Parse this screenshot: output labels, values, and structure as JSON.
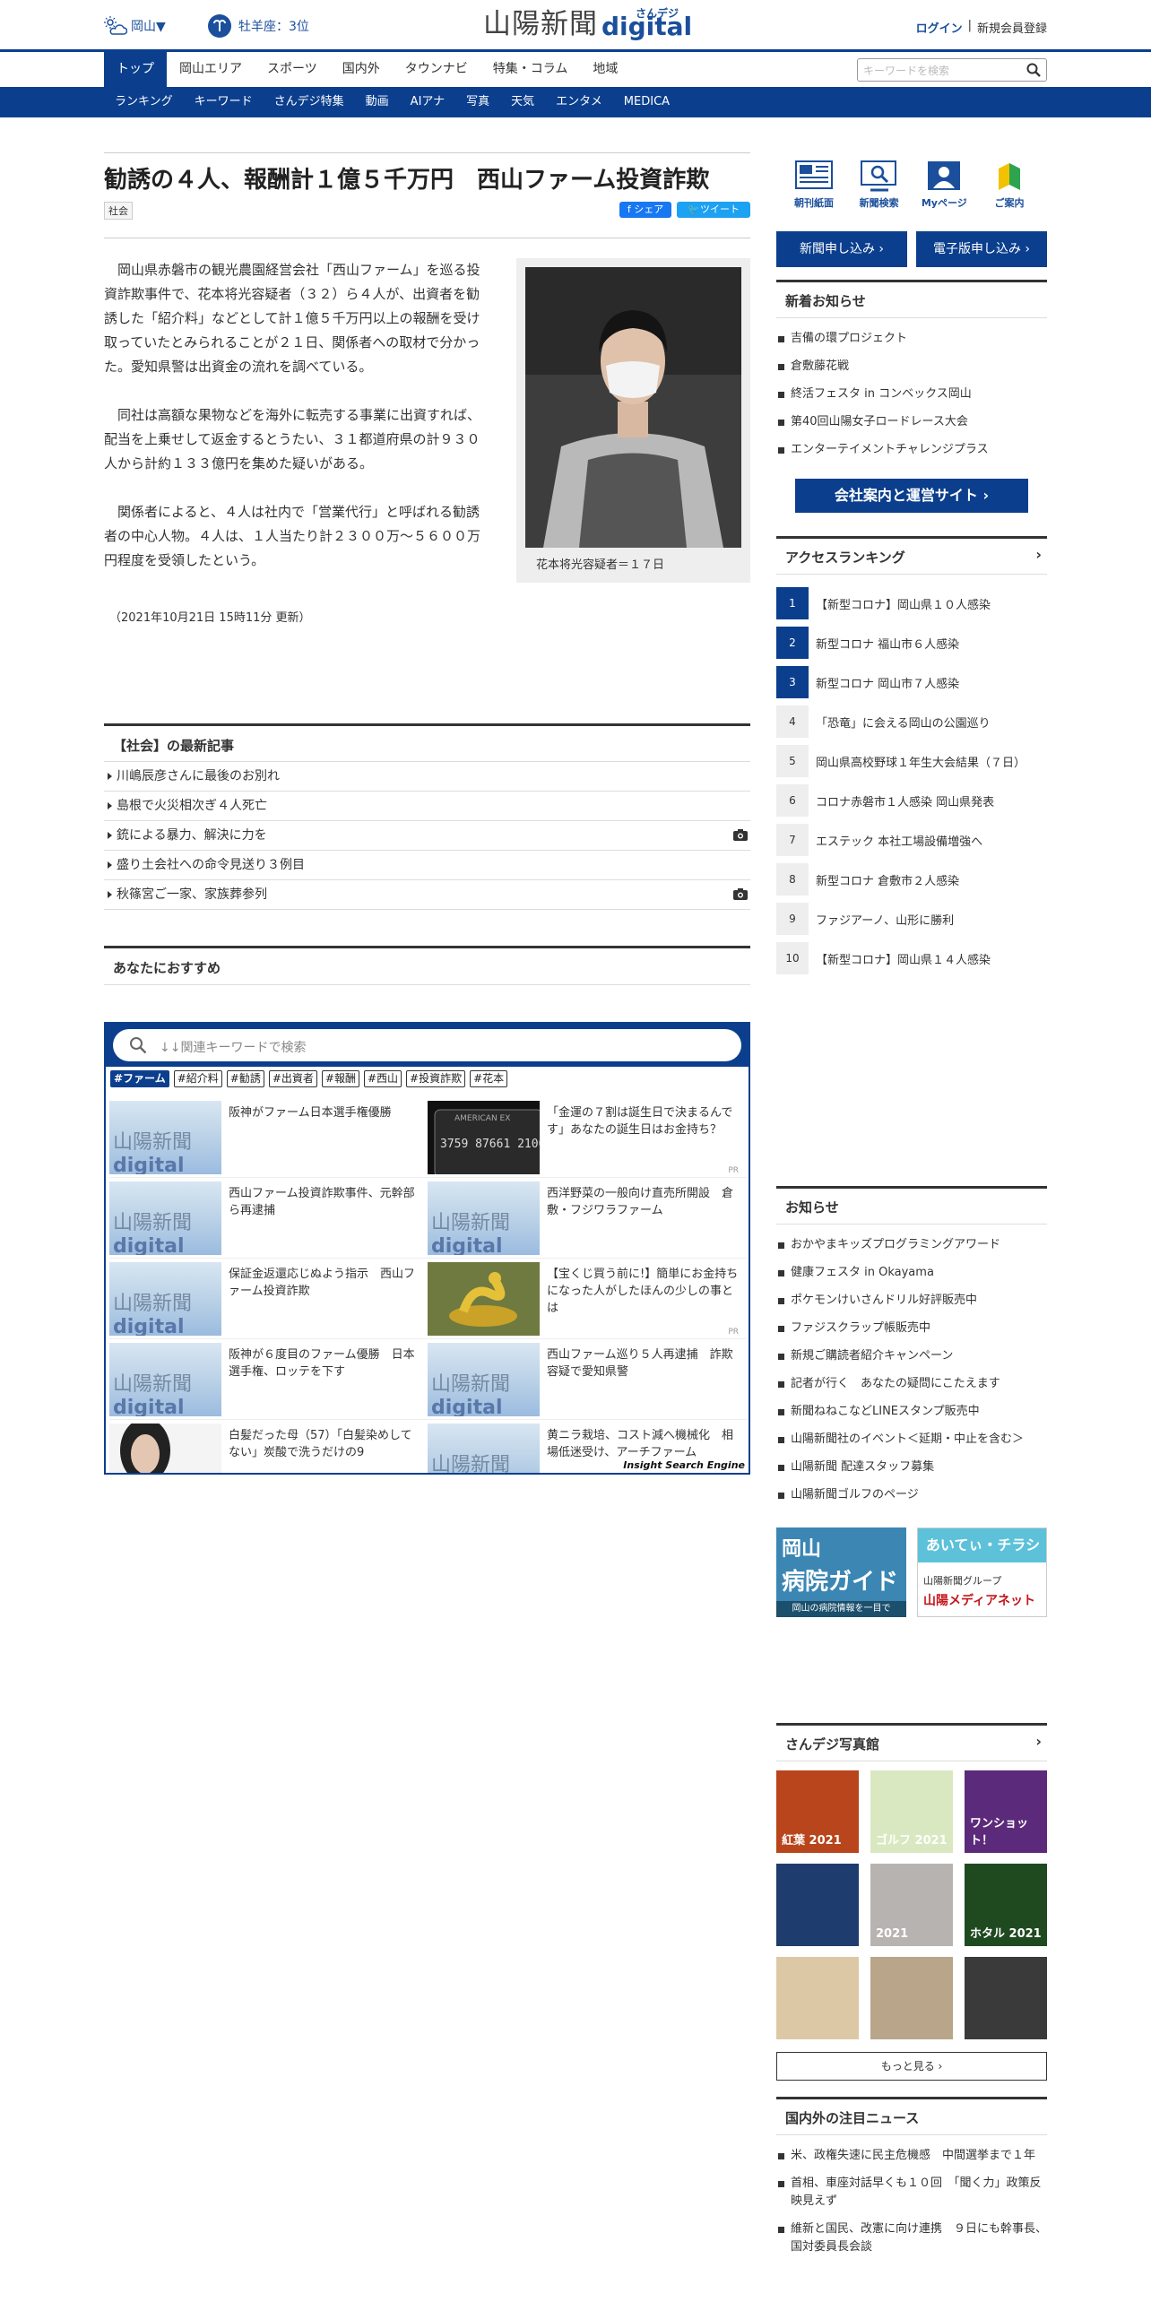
{
  "header": {
    "weather_region": "岡山▼",
    "horoscope": "牡羊座：3位",
    "logo_main": "山陽新聞",
    "logo_sub_kana": "さんデジ",
    "logo_sub": "digital",
    "login": "ログイン",
    "register": "新規会員登録"
  },
  "nav_primary": [
    "トップ",
    "岡山エリア",
    "スポーツ",
    "国内外",
    "タウンナビ",
    "特集・コラム",
    "地域"
  ],
  "search": {
    "placeholder": "キーワードを検索"
  },
  "nav_secondary": [
    "ランキング",
    "キーワード",
    "さんデジ特集",
    "動画",
    "AIアナ",
    "写真",
    "天気",
    "エンタメ",
    "MEDICA"
  ],
  "article": {
    "title": "勧誘の４人、報酬計１億５千万円　西山ファーム投資詐欺",
    "category": "社会",
    "share_fb": "シェア",
    "share_tw": "ツイート",
    "paragraphs": [
      "岡山県赤磐市の観光農園経営会社「西山ファーム」を巡る投資詐欺事件で、花本将光容疑者（３２）ら４人が、出資者を勧誘した「紹介料」などとして計１億５千万円以上の報酬を受け取っていたとみられることが２１日、関係者への取材で分かった。愛知県警は出資金の流れを調べている。",
      "同社は高額な果物などを海外に転売する事業に出資すれば、配当を上乗せして返金するとうたい、３１都道府県の計９３０人から計約１３３億円を集めた疑いがある。",
      "関係者によると、４人は社内で「営業代行」と呼ばれる勧誘者の中心人物。４人は、１人当たり計２３００万～５６００万円程度を受領したという。"
    ],
    "photo_caption": "花本将光容疑者＝１７日",
    "updated": "（2021年10月21日 15時11分 更新）"
  },
  "latest": {
    "heading": "【社会】の最新記事",
    "items": [
      {
        "title": "川嶋辰彦さんに最後のお別れ",
        "photo": false
      },
      {
        "title": "島根で火災相次ぎ４人死亡",
        "photo": false
      },
      {
        "title": "銃による暴力、解決に力を",
        "photo": true
      },
      {
        "title": "盛り土会社への命令見送り３例目",
        "photo": false
      },
      {
        "title": "秋篠宮ご一家、家族葬参列",
        "photo": true
      }
    ]
  },
  "recommend": {
    "heading": "あなたにおすすめ"
  },
  "ise": {
    "placeholder": "↓↓関連キーワードで検索",
    "tags": [
      "#ファーム",
      "#紹介料",
      "#勧誘",
      "#出資者",
      "#報酬",
      "#西山",
      "#投資詐欺",
      "#花本"
    ],
    "rows": [
      [
        {
          "text": "阪神がファーム日本選手権優勝",
          "pr": false,
          "thumb": "logo"
        },
        {
          "text": "「金運の７割は誕生日で決まるんです」あなたの誕生日はお金持ち？",
          "pr": true,
          "thumb": "card"
        }
      ],
      [
        {
          "text": "西山ファーム投資詐欺事件、元幹部ら再逮捕",
          "pr": false,
          "thumb": "logo"
        },
        {
          "text": "西洋野菜の一般向け直売所開設　倉敷・フジワラファーム",
          "pr": false,
          "thumb": "logo"
        }
      ],
      [
        {
          "text": "保証金返還応じぬよう指示　西山ファーム投資詐欺",
          "pr": false,
          "thumb": "logo"
        },
        {
          "text": "【宝くじ買う前に!】簡単にお金持ちになった人がしたほんの少しの事とは",
          "pr": true,
          "thumb": "snake"
        }
      ],
      [
        {
          "text": "阪神が６度目のファーム優勝　日本選手権、ロッテを下す",
          "pr": false,
          "thumb": "logo"
        },
        {
          "text": "西山ファーム巡り５人再逮捕　詐欺容疑で愛知県警",
          "pr": false,
          "thumb": "logo"
        }
      ],
      [
        {
          "text": "白髪だった母（57）「白髪染めしてない」炭酸で洗うだけの9",
          "pr": false,
          "thumb": "woman"
        },
        {
          "text": "黄ニラ栽培、コスト減へ機械化　相場低迷受け、アーチファーム",
          "pr": false,
          "thumb": "logo"
        }
      ]
    ],
    "footer": "Insight Search Engine",
    "pr_label": "PR",
    "thumb_logo": "山陽新聞",
    "thumb_logo_sub": "digital"
  },
  "sidebar": {
    "quick": [
      {
        "label": "朝刊紙面",
        "icon": "newspaper-icon"
      },
      {
        "label": "新聞検索",
        "icon": "monitor-search-icon"
      },
      {
        "label": "Myページ",
        "icon": "user-page-icon"
      },
      {
        "label": "ご案内",
        "icon": "beginner-mark-icon"
      }
    ],
    "btn_subscribe": "新聞申し込み ›",
    "btn_digital": "電子版申し込み ›",
    "news": {
      "heading": "新着お知らせ",
      "items": [
        "吉備の環プロジェクト",
        "倉敷藤花戦",
        "終活フェスタ in コンベックス岡山",
        "第40回山陽女子ロードレース大会",
        "エンターテイメントチャレンジプラス"
      ]
    },
    "company_banner": "会社案内と運営サイト ›",
    "ranking": {
      "heading": "アクセスランキング",
      "items": [
        "【新型コロナ】岡山県１０人感染",
        "新型コロナ 福山市６人感染",
        "新型コロナ 岡山市７人感染",
        "「恐竜」に会える岡山の公園巡り",
        "岡山県高校野球１年生大会結果（７日）",
        "コロナ赤磐市１人感染 岡山県発表",
        "エステック 本社工場設備増強へ",
        "新型コロナ 倉敷市２人感染",
        "ファジアーノ、山形に勝利",
        "【新型コロナ】岡山県１４人感染"
      ]
    },
    "notice": {
      "heading": "お知らせ",
      "items": [
        "おかやまキッズプログラミングアワード",
        "健康フェスタ in Okayama",
        "ポケモンけいさんドリル好評販売中",
        "ファジスクラップ帳販売中",
        "新規ご購読者紹介キャンペーン",
        "記者が行く　あなたの疑問にこたえます",
        "新聞ねねこなどLINEスタンプ販売中",
        "山陽新聞社のイベント＜延期・中止を含む＞",
        "山陽新聞 配達スタッフ募集",
        "山陽新聞ゴルフのページ"
      ]
    },
    "ad_hospital": {
      "line1": "岡山",
      "line2": "病院ガイド",
      "line3": "岡山の病院情報を一目で"
    },
    "ad_chirashi": {
      "line1": "あいてぃ・チラシ",
      "line2": "山陽新聞グループ",
      "line3": "山陽メディアネット"
    },
    "photos": {
      "heading": "さんデジ写真館",
      "tiles": [
        {
          "label": "紅葉 2021",
          "bg": "#b8451c"
        },
        {
          "label": "ゴルフ 2021",
          "bg": "#d9e8c0"
        },
        {
          "label": "ワンショット！",
          "bg": "#5c2a7a"
        },
        {
          "label": "",
          "bg": "#1f3c6e"
        },
        {
          "label": "2021",
          "bg": "#b7b3b0"
        },
        {
          "label": "ホタル 2021",
          "bg": "#1f4a20"
        },
        {
          "label": "",
          "bg": "#ddc8a6"
        },
        {
          "label": "",
          "bg": "#b9a58a"
        },
        {
          "label": "",
          "bg": "#3a3a3a"
        }
      ],
      "more": "もっと見る ›"
    },
    "world": {
      "heading": "国内外の注目ニュース",
      "items": [
        "米、政権失速に民主危機感　中間選挙まで１年",
        "首相、車座対話早くも１０回　「聞く力」政策反映見えず",
        "維新と国民、改憲に向け連携　９日にも幹事長、国対委員長会談"
      ]
    }
  },
  "colors": {
    "brand": "#0b3f8e",
    "text": "#333333"
  }
}
